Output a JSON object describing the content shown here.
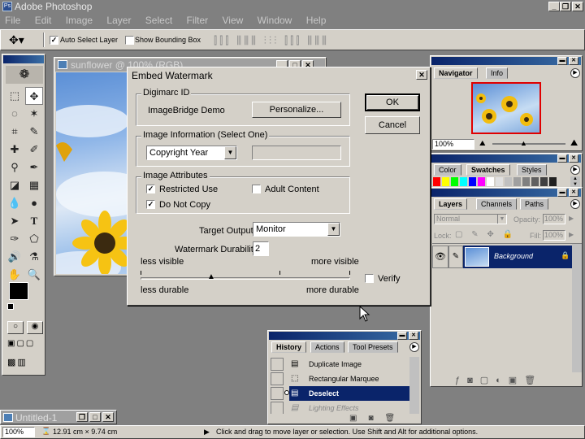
{
  "app": {
    "title": "Adobe Photoshop"
  },
  "menu": [
    "File",
    "Edit",
    "Image",
    "Layer",
    "Select",
    "Filter",
    "View",
    "Window",
    "Help"
  ],
  "options_bar": {
    "auto_select_label": "Auto Select Layer",
    "bounding_box_label": "Show Bounding Box"
  },
  "document": {
    "title": "sunflower @ 100% (RGB)"
  },
  "minimized_doc": {
    "title": "Untitled-1"
  },
  "dialog": {
    "title": "Embed Watermark",
    "digimarc_group": "Digimarc ID",
    "digimarc_id": "ImageBridge Demo",
    "personalize_button": "Personalize...",
    "image_info_group": "Image Information (Select One)",
    "image_info_selected": "Copyright Year",
    "image_info_value": "",
    "image_attr_group": "Image Attributes",
    "restricted_use": "Restricted Use",
    "adult_content": "Adult Content",
    "do_not_copy": "Do Not Copy",
    "restricted_checked": true,
    "adult_checked": false,
    "donotcopy_checked": true,
    "target_output_label": "Target Output:",
    "target_output_value": "Monitor",
    "durability_label": "Watermark Durability:",
    "durability_value": "2",
    "less_visible": "less visible",
    "more_visible": "more visible",
    "less_durable": "less durable",
    "more_durable": "more durable",
    "verify_label": "Verify",
    "ok_button": "OK",
    "cancel_button": "Cancel"
  },
  "navigator": {
    "tabs": [
      "Navigator",
      "Info"
    ],
    "zoom": "100%"
  },
  "swatches": {
    "tabs": [
      "Color",
      "Swatches",
      "Styles"
    ],
    "colors": [
      "#ff0000",
      "#ffff00",
      "#00ff00",
      "#00ffff",
      "#0000ff",
      "#ff00ff",
      "#ffffff",
      "#e0e0e0",
      "#c0c0c0",
      "#a0a0a0",
      "#808080",
      "#606060",
      "#404040",
      "#202020"
    ]
  },
  "layers": {
    "tabs": [
      "Layers",
      "Channels",
      "Paths"
    ],
    "blend_mode": "Normal",
    "opacity_label": "Opacity:",
    "opacity": "100%",
    "lock_label": "Lock:",
    "fill_label": "Fill:",
    "fill": "100%",
    "layer_name": "Background"
  },
  "history": {
    "tabs": [
      "History",
      "Actions",
      "Tool Presets"
    ],
    "items": [
      "Duplicate Image",
      "Rectangular Marquee",
      "Deselect",
      "Lighting Effects"
    ]
  },
  "status": {
    "zoom": "100%",
    "doc_size": "12.91 cm × 9.74 cm",
    "hint": "Click and drag to move layer or selection.  Use Shift and Alt for additional options."
  }
}
